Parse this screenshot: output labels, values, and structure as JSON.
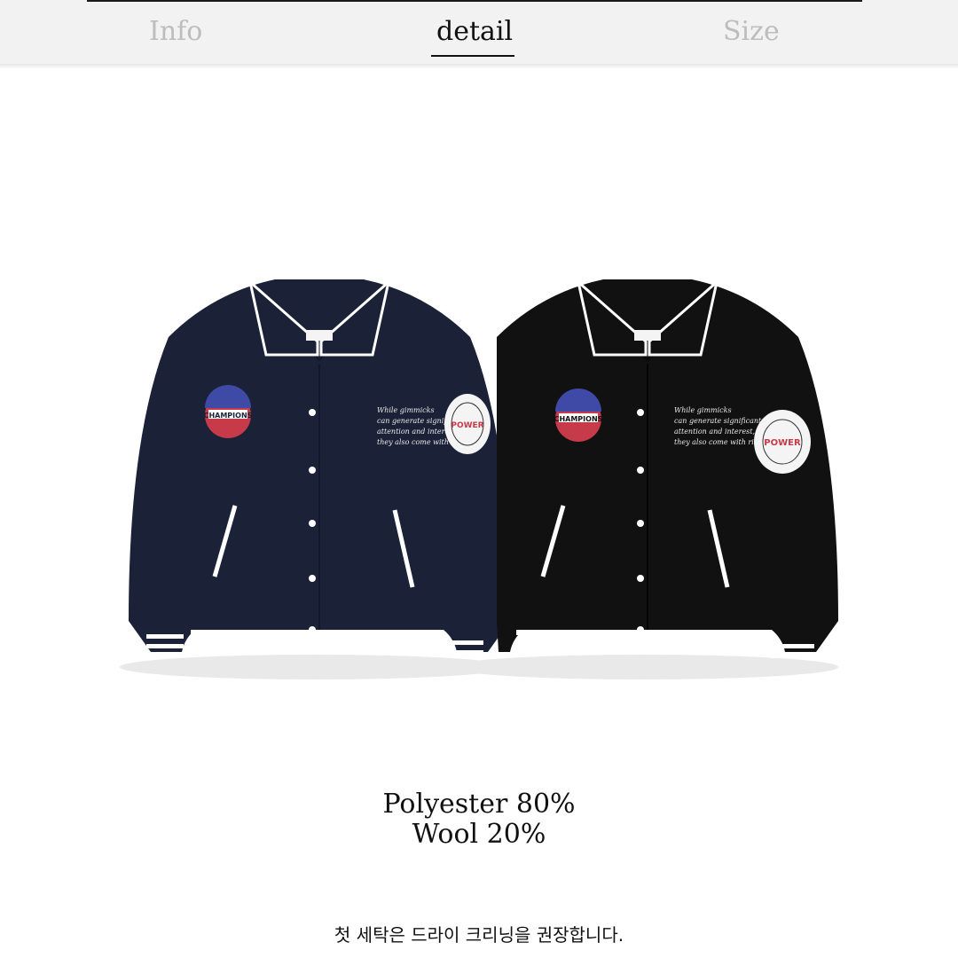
{
  "tabs": [
    {
      "label": "Info"
    },
    {
      "label": "detail",
      "active": true
    },
    {
      "label": "Size"
    }
  ],
  "product": {
    "jackets": [
      {
        "color": "#1b2238",
        "patch_left": "CHAMPIONS",
        "patch_right": "POWER",
        "chest_text": "While gimmicks can generate significant attention and interest, they also come with risks."
      },
      {
        "color": "#111111",
        "patch_left": "CHAMPIONS",
        "patch_right": "POWER",
        "chest_text": "While gimmicks can generate significant attention and interest, they also come with risks."
      }
    ]
  },
  "material": {
    "line1": "Polyester 80%",
    "line2": "Wool 20%"
  },
  "care_note": "첫 세탁은 드라이 크리닝을 권장합니다."
}
